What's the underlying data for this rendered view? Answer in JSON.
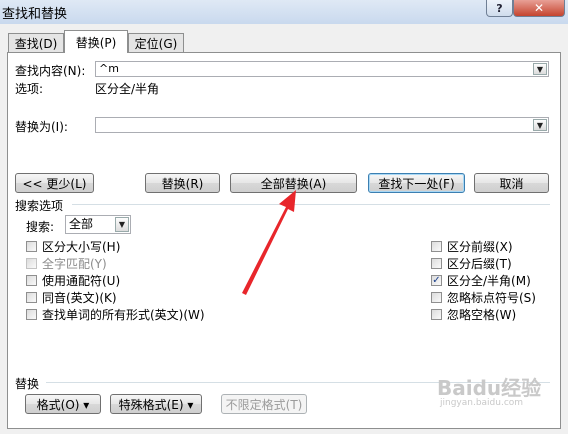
{
  "window": {
    "title": "查找和替换",
    "help_label": "?",
    "close_label": "✕"
  },
  "tabs": [
    {
      "label": "查找(D)"
    },
    {
      "label": "替换(P)"
    },
    {
      "label": "定位(G)"
    }
  ],
  "find": {
    "label": "查找内容(N):",
    "value": "^m"
  },
  "options": {
    "label": "选项:",
    "value": "区分全/半角"
  },
  "replace": {
    "label": "替换为(I):",
    "value": ""
  },
  "buttons": {
    "less": "<< 更少(L)",
    "replace": "替换(R)",
    "replace_all": "全部替换(A)",
    "find_next": "查找下一处(F)",
    "cancel": "取消"
  },
  "search_options": {
    "heading": "搜索选项",
    "search_label": "搜索:",
    "search_value": "全部",
    "left": [
      {
        "label": "区分大小写(H)",
        "checked": false,
        "disabled": false
      },
      {
        "label": "全字匹配(Y)",
        "checked": false,
        "disabled": true
      },
      {
        "label": "使用通配符(U)",
        "checked": false,
        "disabled": false
      },
      {
        "label": "同音(英文)(K)",
        "checked": false,
        "disabled": false
      },
      {
        "label": "查找单词的所有形式(英文)(W)",
        "checked": false,
        "disabled": false
      }
    ],
    "right": [
      {
        "label": "区分前缀(X)",
        "checked": false,
        "disabled": false
      },
      {
        "label": "区分后缀(T)",
        "checked": false,
        "disabled": false
      },
      {
        "label": "区分全/半角(M)",
        "checked": true,
        "disabled": false
      },
      {
        "label": "忽略标点符号(S)",
        "checked": false,
        "disabled": false
      },
      {
        "label": "忽略空格(W)",
        "checked": false,
        "disabled": false
      }
    ]
  },
  "replace_section": {
    "heading": "替换",
    "format_btn": "格式(O) ▾",
    "special_btn": "特殊格式(E) ▾",
    "no_format_btn": "不限定格式(T)"
  },
  "watermark": {
    "text": "Baidu经验",
    "sub": "jingyan.baidu.com"
  },
  "colors": {
    "arrow": "#e8262b",
    "title_bar": "#c9d9ee",
    "close": "#c5442e"
  }
}
